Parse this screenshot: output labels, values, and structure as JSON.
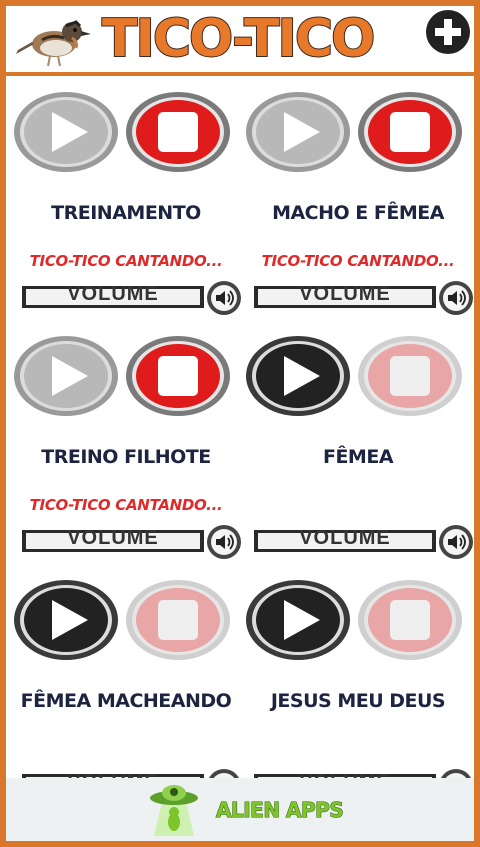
{
  "header": {
    "title": "TICO-TICO",
    "add_icon": "plus-circle-icon"
  },
  "colors": {
    "frame": "#d9772b",
    "title": "#e8792a",
    "play_active": "#222222",
    "play_inactive": "#b8b8b8",
    "stop_active": "#e01b1b",
    "stop_inactive": "#e8a6a6",
    "status_text": "#e02a2a",
    "card_title": "#1d2440",
    "ad_text": "#7dc52b"
  },
  "cards": [
    {
      "title": "TREINAMENTO",
      "status": "TICO-TICO CANTANDO...",
      "volume_label": "VOLUME",
      "playing": true
    },
    {
      "title": "MACHO E FÊMEA",
      "status": "TICO-TICO CANTANDO...",
      "volume_label": "VOLUME",
      "playing": true
    },
    {
      "title": "TREINO FILHOTE",
      "status": "TICO-TICO CANTANDO...",
      "volume_label": "VOLUME",
      "playing": true
    },
    {
      "title": "FÊMEA",
      "status": "",
      "volume_label": "VOLUME",
      "playing": false
    },
    {
      "title": "FÊMEA MACHEANDO",
      "status": "",
      "volume_label": "VOLUME",
      "playing": false
    },
    {
      "title": "JESUS MEU DEUS",
      "status": "",
      "volume_label": "VOLUME",
      "playing": false
    }
  ],
  "ad": {
    "label": "ALIEN APPS",
    "icon": "ufo-alien-icon"
  }
}
